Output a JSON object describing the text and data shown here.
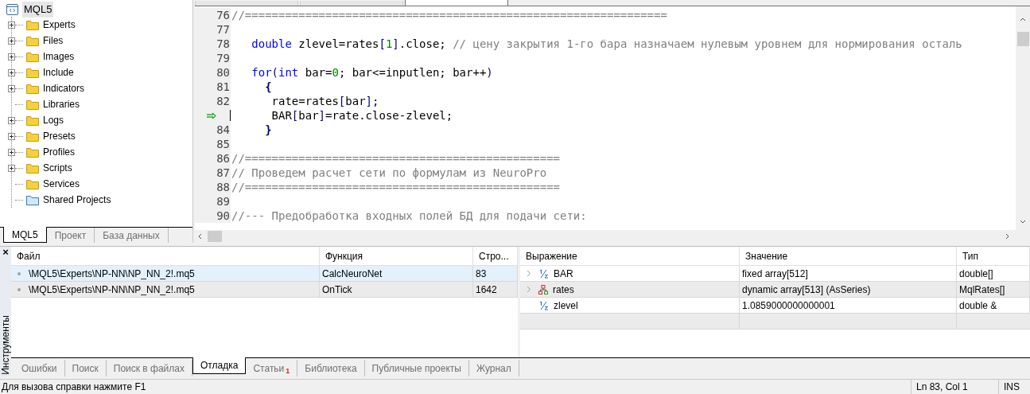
{
  "navigator": {
    "root": {
      "label": "MQL5",
      "selected": true,
      "children": [
        {
          "label": "Experts",
          "expandable": true,
          "kind": "folder"
        },
        {
          "label": "Files",
          "expandable": true,
          "kind": "folder"
        },
        {
          "label": "Images",
          "expandable": true,
          "kind": "folder"
        },
        {
          "label": "Include",
          "expandable": true,
          "kind": "folder"
        },
        {
          "label": "Indicators",
          "expandable": true,
          "kind": "folder"
        },
        {
          "label": "Libraries",
          "expandable": false,
          "kind": "folder"
        },
        {
          "label": "Logs",
          "expandable": true,
          "kind": "folder"
        },
        {
          "label": "Presets",
          "expandable": true,
          "kind": "folder"
        },
        {
          "label": "Profiles",
          "expandable": true,
          "kind": "folder"
        },
        {
          "label": "Scripts",
          "expandable": true,
          "kind": "folder"
        },
        {
          "label": "Services",
          "expandable": false,
          "kind": "folder"
        },
        {
          "label": "Shared Projects",
          "expandable": false,
          "kind": "shared"
        }
      ]
    },
    "tabs": [
      {
        "label": "MQL5",
        "selected": true
      },
      {
        "label": "Проект",
        "selected": false
      },
      {
        "label": "База данных",
        "selected": false
      }
    ]
  },
  "editor": {
    "file_tabs": [
      {
        "selected": false
      },
      {
        "selected": false
      },
      {
        "selected": true
      }
    ],
    "lines": [
      {
        "number": "76",
        "current": false,
        "tokens": [
          {
            "kind": "comment",
            "text": "//==============================================================="
          }
        ]
      },
      {
        "number": "77",
        "current": false
      },
      {
        "number": "78",
        "current": false,
        "tokens": [
          {
            "kind": "keyword",
            "text": "   double"
          },
          {
            "kind": "plain",
            "text": " zlevel=rates"
          },
          {
            "kind": "bracket",
            "text": "["
          },
          {
            "kind": "number",
            "text": "1"
          },
          {
            "kind": "bracket",
            "text": "]"
          },
          {
            "kind": "plain",
            "text": ".close; "
          },
          {
            "kind": "comment",
            "text": "// цену закрытия 1-го бара назначаем нулевым уровнем для нормирования осталь"
          }
        ]
      },
      {
        "number": "79",
        "current": false
      },
      {
        "number": "80",
        "current": false,
        "tokens": [
          {
            "kind": "keyword",
            "text": "   for"
          },
          {
            "kind": "bracket",
            "text": "("
          },
          {
            "kind": "keyword",
            "text": "int"
          },
          {
            "kind": "plain",
            "text": " bar="
          },
          {
            "kind": "number",
            "text": "0"
          },
          {
            "kind": "plain",
            "text": "; bar<=inputlen; bar++"
          },
          {
            "kind": "bracket",
            "text": ")"
          }
        ]
      },
      {
        "number": "81",
        "current": false,
        "tokens": [
          {
            "kind": "brace",
            "text": "     {"
          }
        ]
      },
      {
        "number": "82",
        "current": false,
        "tokens": [
          {
            "kind": "plain",
            "text": "      rate=rates"
          },
          {
            "kind": "bracket",
            "text": "["
          },
          {
            "kind": "plain",
            "text": "bar"
          },
          {
            "kind": "bracket",
            "text": "]"
          },
          {
            "kind": "plain",
            "text": ";"
          }
        ]
      },
      {
        "current": true,
        "tokens": [
          {
            "kind": "plain",
            "text": "      BAR"
          },
          {
            "kind": "bracket",
            "text": "["
          },
          {
            "kind": "plain",
            "text": "bar"
          },
          {
            "kind": "bracket",
            "text": "]"
          },
          {
            "kind": "plain",
            "text": "=rate.close-zlevel;"
          }
        ]
      },
      {
        "number": "84",
        "current": false,
        "tokens": [
          {
            "kind": "brace",
            "text": "     }"
          }
        ]
      },
      {
        "number": "85",
        "current": false
      },
      {
        "number": "86",
        "current": false,
        "tokens": [
          {
            "kind": "comment",
            "text": "//==============================================="
          }
        ]
      },
      {
        "number": "87",
        "current": false,
        "tokens": [
          {
            "kind": "comment",
            "text": "// Проведем расчет сети по формулам из NeuroPro"
          }
        ]
      },
      {
        "number": "88",
        "current": false,
        "tokens": [
          {
            "kind": "comment",
            "text": "//==============================================="
          }
        ]
      },
      {
        "number": "89",
        "current": false
      },
      {
        "number": "90",
        "current": false,
        "tokens": [
          {
            "kind": "comment",
            "text": "//--- Предобработка входных полей БД для подачи сети:"
          }
        ]
      }
    ]
  },
  "toolbox": {
    "title": "Инструменты",
    "close": "×",
    "callstack": {
      "columns": [
        "Файл",
        "Функция",
        "Стро..."
      ],
      "rows": [
        {
          "selected": true,
          "cells": [
            "\\MQL5\\Experts\\NP-NN\\NP_NN_2!.mq5",
            "CalcNeuroNet",
            "83"
          ]
        },
        {
          "selected": false,
          "cells": [
            "\\MQL5\\Experts\\NP-NN\\NP_NN_2!.mq5",
            "OnTick",
            "1642"
          ]
        }
      ]
    },
    "watch": {
      "columns": [
        "Выражение",
        "Значение",
        "Тип"
      ],
      "rows": [
        {
          "expandable": true,
          "kind": "number",
          "cells": [
            "BAR",
            "fixed array[512]",
            "double[]"
          ]
        },
        {
          "expandable": true,
          "kind": "struct",
          "cells": [
            "rates",
            "dynamic array[513] (AsSeries)",
            "MqlRates[]"
          ]
        },
        {
          "expandable": false,
          "kind": "number",
          "cells": [
            "zlevel",
            "1.0859000000000001",
            "double &"
          ]
        }
      ]
    },
    "tabs": [
      {
        "label": "Ошибки",
        "selected": false
      },
      {
        "label": "Поиск",
        "selected": false
      },
      {
        "label": "Поиск в файлах",
        "selected": false
      },
      {
        "label": "Отладка",
        "selected": true
      },
      {
        "label": "Статьи",
        "selected": false,
        "badge": "1"
      },
      {
        "label": "Библиотека",
        "selected": false
      },
      {
        "label": "Публичные проекты",
        "selected": false
      },
      {
        "label": "Журнал",
        "selected": false
      }
    ]
  },
  "status_bar": {
    "hint": "Для вызова справки нажмите F1",
    "position": "Ln 83, Col 1",
    "mode": "INS"
  }
}
